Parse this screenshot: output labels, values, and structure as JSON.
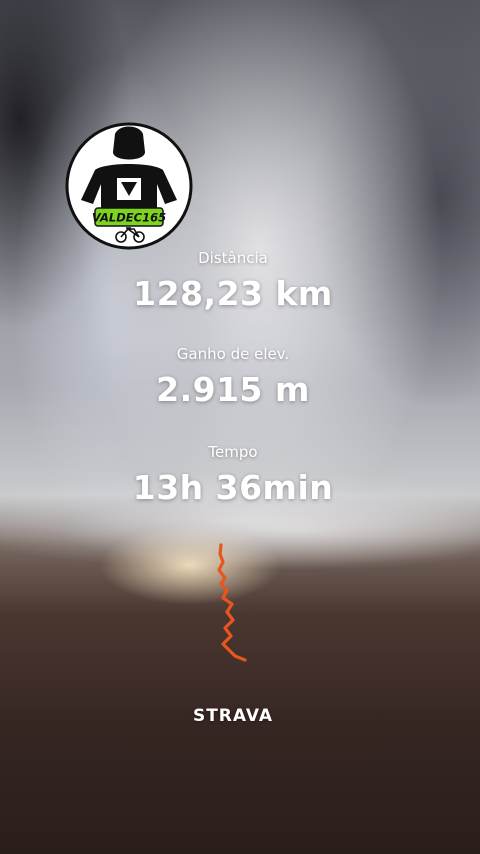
{
  "stats": {
    "distance": {
      "label": "Distância",
      "value": "128,23 km"
    },
    "elevation": {
      "label": "Ganho de elev.",
      "value": "2.915 m"
    },
    "time": {
      "label": "Tempo",
      "value": "13h 36min"
    }
  },
  "logo": {
    "text": "VALDEC165"
  },
  "brand": {
    "name": "STRAVA"
  },
  "colors": {
    "route": "#e8551e",
    "logo_badge": "#7ed321"
  }
}
